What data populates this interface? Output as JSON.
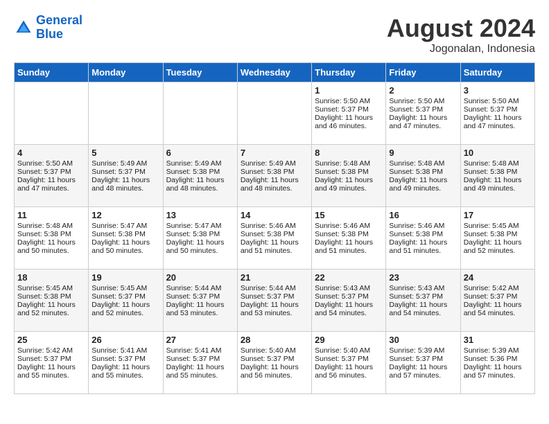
{
  "header": {
    "logo_line1": "General",
    "logo_line2": "Blue",
    "month_year": "August 2024",
    "location": "Jogonalan, Indonesia"
  },
  "weekdays": [
    "Sunday",
    "Monday",
    "Tuesday",
    "Wednesday",
    "Thursday",
    "Friday",
    "Saturday"
  ],
  "weeks": [
    [
      {
        "day": "",
        "sunrise": "",
        "sunset": "",
        "daylight": ""
      },
      {
        "day": "",
        "sunrise": "",
        "sunset": "",
        "daylight": ""
      },
      {
        "day": "",
        "sunrise": "",
        "sunset": "",
        "daylight": ""
      },
      {
        "day": "",
        "sunrise": "",
        "sunset": "",
        "daylight": ""
      },
      {
        "day": "1",
        "sunrise": "Sunrise: 5:50 AM",
        "sunset": "Sunset: 5:37 PM",
        "daylight": "Daylight: 11 hours and 46 minutes."
      },
      {
        "day": "2",
        "sunrise": "Sunrise: 5:50 AM",
        "sunset": "Sunset: 5:37 PM",
        "daylight": "Daylight: 11 hours and 47 minutes."
      },
      {
        "day": "3",
        "sunrise": "Sunrise: 5:50 AM",
        "sunset": "Sunset: 5:37 PM",
        "daylight": "Daylight: 11 hours and 47 minutes."
      }
    ],
    [
      {
        "day": "4",
        "sunrise": "Sunrise: 5:50 AM",
        "sunset": "Sunset: 5:37 PM",
        "daylight": "Daylight: 11 hours and 47 minutes."
      },
      {
        "day": "5",
        "sunrise": "Sunrise: 5:49 AM",
        "sunset": "Sunset: 5:37 PM",
        "daylight": "Daylight: 11 hours and 48 minutes."
      },
      {
        "day": "6",
        "sunrise": "Sunrise: 5:49 AM",
        "sunset": "Sunset: 5:38 PM",
        "daylight": "Daylight: 11 hours and 48 minutes."
      },
      {
        "day": "7",
        "sunrise": "Sunrise: 5:49 AM",
        "sunset": "Sunset: 5:38 PM",
        "daylight": "Daylight: 11 hours and 48 minutes."
      },
      {
        "day": "8",
        "sunrise": "Sunrise: 5:48 AM",
        "sunset": "Sunset: 5:38 PM",
        "daylight": "Daylight: 11 hours and 49 minutes."
      },
      {
        "day": "9",
        "sunrise": "Sunrise: 5:48 AM",
        "sunset": "Sunset: 5:38 PM",
        "daylight": "Daylight: 11 hours and 49 minutes."
      },
      {
        "day": "10",
        "sunrise": "Sunrise: 5:48 AM",
        "sunset": "Sunset: 5:38 PM",
        "daylight": "Daylight: 11 hours and 49 minutes."
      }
    ],
    [
      {
        "day": "11",
        "sunrise": "Sunrise: 5:48 AM",
        "sunset": "Sunset: 5:38 PM",
        "daylight": "Daylight: 11 hours and 50 minutes."
      },
      {
        "day": "12",
        "sunrise": "Sunrise: 5:47 AM",
        "sunset": "Sunset: 5:38 PM",
        "daylight": "Daylight: 11 hours and 50 minutes."
      },
      {
        "day": "13",
        "sunrise": "Sunrise: 5:47 AM",
        "sunset": "Sunset: 5:38 PM",
        "daylight": "Daylight: 11 hours and 50 minutes."
      },
      {
        "day": "14",
        "sunrise": "Sunrise: 5:46 AM",
        "sunset": "Sunset: 5:38 PM",
        "daylight": "Daylight: 11 hours and 51 minutes."
      },
      {
        "day": "15",
        "sunrise": "Sunrise: 5:46 AM",
        "sunset": "Sunset: 5:38 PM",
        "daylight": "Daylight: 11 hours and 51 minutes."
      },
      {
        "day": "16",
        "sunrise": "Sunrise: 5:46 AM",
        "sunset": "Sunset: 5:38 PM",
        "daylight": "Daylight: 11 hours and 51 minutes."
      },
      {
        "day": "17",
        "sunrise": "Sunrise: 5:45 AM",
        "sunset": "Sunset: 5:38 PM",
        "daylight": "Daylight: 11 hours and 52 minutes."
      }
    ],
    [
      {
        "day": "18",
        "sunrise": "Sunrise: 5:45 AM",
        "sunset": "Sunset: 5:38 PM",
        "daylight": "Daylight: 11 hours and 52 minutes."
      },
      {
        "day": "19",
        "sunrise": "Sunrise: 5:45 AM",
        "sunset": "Sunset: 5:37 PM",
        "daylight": "Daylight: 11 hours and 52 minutes."
      },
      {
        "day": "20",
        "sunrise": "Sunrise: 5:44 AM",
        "sunset": "Sunset: 5:37 PM",
        "daylight": "Daylight: 11 hours and 53 minutes."
      },
      {
        "day": "21",
        "sunrise": "Sunrise: 5:44 AM",
        "sunset": "Sunset: 5:37 PM",
        "daylight": "Daylight: 11 hours and 53 minutes."
      },
      {
        "day": "22",
        "sunrise": "Sunrise: 5:43 AM",
        "sunset": "Sunset: 5:37 PM",
        "daylight": "Daylight: 11 hours and 54 minutes."
      },
      {
        "day": "23",
        "sunrise": "Sunrise: 5:43 AM",
        "sunset": "Sunset: 5:37 PM",
        "daylight": "Daylight: 11 hours and 54 minutes."
      },
      {
        "day": "24",
        "sunrise": "Sunrise: 5:42 AM",
        "sunset": "Sunset: 5:37 PM",
        "daylight": "Daylight: 11 hours and 54 minutes."
      }
    ],
    [
      {
        "day": "25",
        "sunrise": "Sunrise: 5:42 AM",
        "sunset": "Sunset: 5:37 PM",
        "daylight": "Daylight: 11 hours and 55 minutes."
      },
      {
        "day": "26",
        "sunrise": "Sunrise: 5:41 AM",
        "sunset": "Sunset: 5:37 PM",
        "daylight": "Daylight: 11 hours and 55 minutes."
      },
      {
        "day": "27",
        "sunrise": "Sunrise: 5:41 AM",
        "sunset": "Sunset: 5:37 PM",
        "daylight": "Daylight: 11 hours and 55 minutes."
      },
      {
        "day": "28",
        "sunrise": "Sunrise: 5:40 AM",
        "sunset": "Sunset: 5:37 PM",
        "daylight": "Daylight: 11 hours and 56 minutes."
      },
      {
        "day": "29",
        "sunrise": "Sunrise: 5:40 AM",
        "sunset": "Sunset: 5:37 PM",
        "daylight": "Daylight: 11 hours and 56 minutes."
      },
      {
        "day": "30",
        "sunrise": "Sunrise: 5:39 AM",
        "sunset": "Sunset: 5:37 PM",
        "daylight": "Daylight: 11 hours and 57 minutes."
      },
      {
        "day": "31",
        "sunrise": "Sunrise: 5:39 AM",
        "sunset": "Sunset: 5:36 PM",
        "daylight": "Daylight: 11 hours and 57 minutes."
      }
    ]
  ]
}
